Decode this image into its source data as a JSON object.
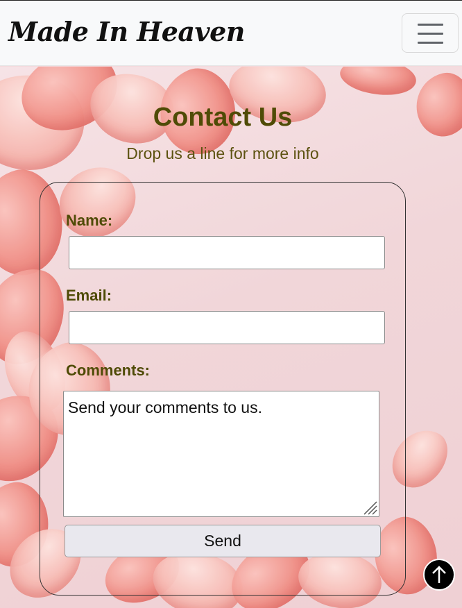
{
  "navbar": {
    "brand": "Made In Heaven",
    "menu_icon": "hamburger-menu-icon"
  },
  "header": {
    "title": "Contact Us",
    "subtitle": "Drop us a line for more info"
  },
  "form": {
    "name_label": "Name:",
    "name_value": "",
    "email_label": "Email:",
    "email_value": "",
    "comments_label": "Comments:",
    "comments_value": "Send your comments to us.",
    "send_label": "Send"
  },
  "back_to_top_icon": "arrow-up-icon",
  "colors": {
    "heading": "#4f4b06",
    "navbar_bg": "#f8f9fa",
    "button_bg": "#e9e8ee"
  }
}
